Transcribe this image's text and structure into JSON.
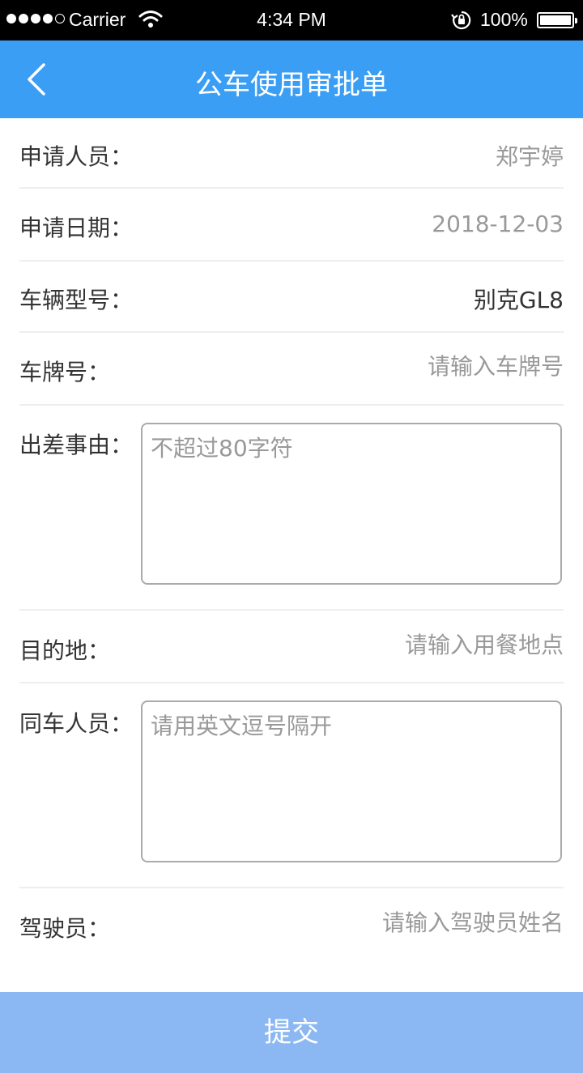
{
  "status_bar": {
    "carrier": "Carrier",
    "time": "4:34 PM",
    "battery_percent": "100%",
    "signal_bars_filled": 4,
    "signal_bars_total": 5,
    "icons": [
      "signal-icon",
      "wifi-icon",
      "orientation-lock-icon",
      "battery-icon"
    ]
  },
  "nav": {
    "title": "公车使用审批单",
    "back_icon": "chevron-left-icon",
    "bg_color": "#3a9ef4"
  },
  "form": {
    "applicant": {
      "label": "申请人员：",
      "value": "郑宇婷"
    },
    "date": {
      "label": "申请日期：",
      "value": "2018-12-03"
    },
    "vehicle_model": {
      "label": "车辆型号：",
      "value": "别克GL8"
    },
    "plate": {
      "label": "车牌号：",
      "value": "",
      "placeholder": "请输入车牌号"
    },
    "reason": {
      "label": "出差事由：",
      "value": "",
      "placeholder": "不超过80字符"
    },
    "destination": {
      "label": "目的地：",
      "value": "",
      "placeholder": "请输入用餐地点"
    },
    "companions": {
      "label": "同车人员：",
      "value": "",
      "placeholder": "请用英文逗号隔开"
    },
    "driver": {
      "label": "驾驶员：",
      "value": "",
      "placeholder": "请输入驾驶员姓名"
    }
  },
  "submit": {
    "label": "提交",
    "bg_color": "#8bb8f3"
  }
}
